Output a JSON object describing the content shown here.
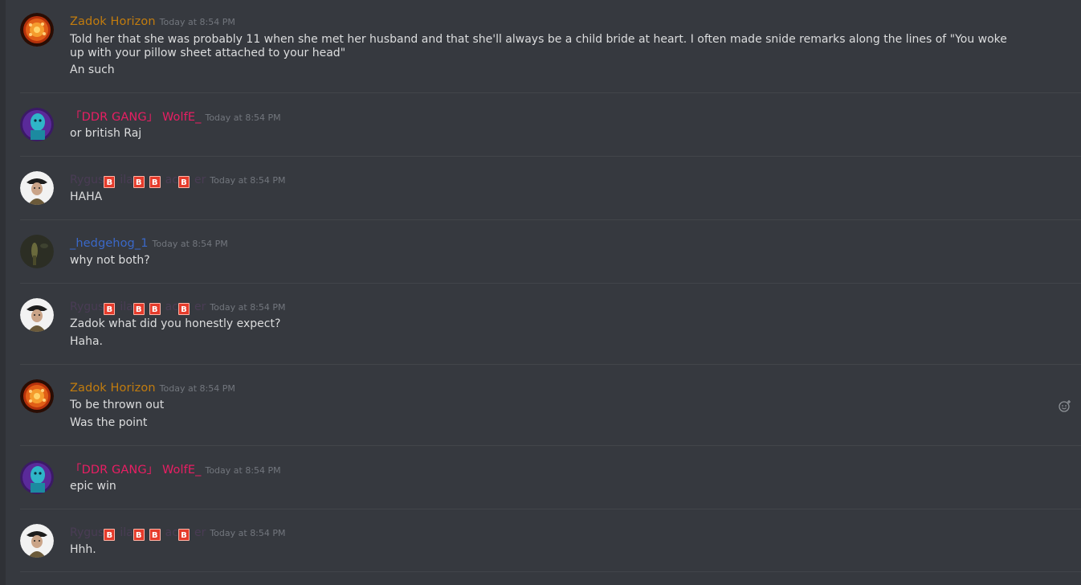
{
  "messages": [
    {
      "author": "Zadok Horizon",
      "author_color": "#c27c0e",
      "time": "Today at 8:54 PM",
      "lines": [
        "Told her that she was probably 11 when she met her husband and that she'll always be a child bride at heart. I often made snide remarks along the lines of \"You woke up with your pillow sheet attached to your head\"",
        "An such"
      ]
    },
    {
      "author": "「DDR GANG」 WolfE_",
      "author_color": "#e91e63",
      "time": "Today at 8:54 PM",
      "lines": [
        "or british Raj"
      ]
    },
    {
      "author": "Rygus",
      "author_color": "#4a3c55",
      "badge": "B",
      "name_fragments": [
        "Rygus",
        "ila",
        "",
        "ac",
        "er"
      ],
      "time": "Today at 8:54 PM",
      "lines": [
        "HAHA"
      ]
    },
    {
      "author": "_hedgehog_1",
      "author_color": "#3a68c8",
      "time": "Today at 8:54 PM",
      "lines": [
        "why not both?"
      ]
    },
    {
      "author": "Rygus",
      "author_color": "#4a3c55",
      "badge": "B",
      "name_fragments": [
        "Rygus",
        "ila",
        "",
        "ac",
        "er"
      ],
      "time": "Today at 8:54 PM",
      "lines": [
        "Zadok what did you honestly expect?",
        "Haha."
      ]
    },
    {
      "author": "Zadok Horizon",
      "author_color": "#c27c0e",
      "time": "Today at 8:54 PM",
      "lines": [
        "To be thrown out",
        "Was the point"
      ]
    },
    {
      "author": "「DDR GANG」 WolfE_",
      "author_color": "#e91e63",
      "time": "Today at 8:54 PM",
      "lines": [
        "epic win"
      ]
    },
    {
      "author": "Rygus",
      "author_color": "#4a3c55",
      "badge": "B",
      "name_fragments": [
        "Rygus",
        "ila",
        "",
        "ac",
        "er"
      ],
      "time": "Today at 8:54 PM",
      "lines": [
        "Hhh."
      ]
    }
  ],
  "icons": {
    "reaction": "add-reaction-icon"
  }
}
